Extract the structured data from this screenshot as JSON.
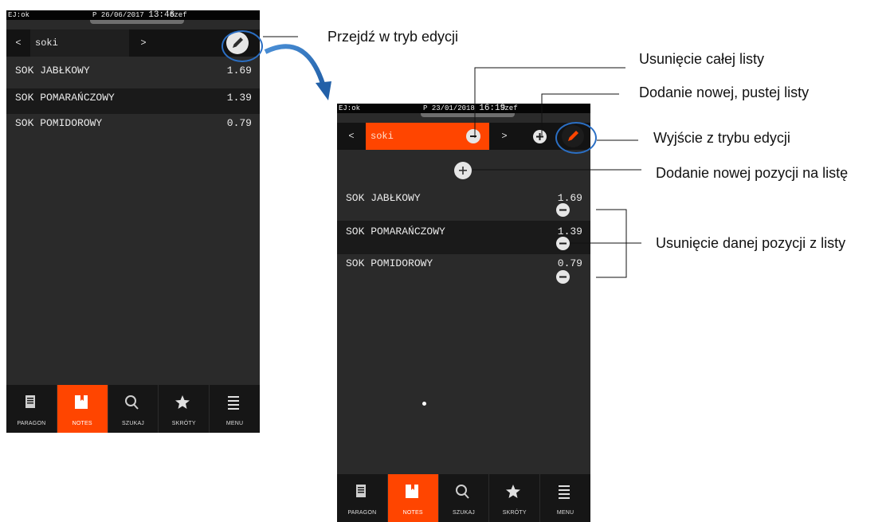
{
  "phone_view": {
    "status": {
      "ej": "EJ:ok",
      "prefix": "P",
      "date": "26/06/2017",
      "time": "13:46",
      "user": "Szef"
    },
    "list_name": "soki",
    "nav_prev": "<",
    "nav_next": ">",
    "items": [
      {
        "name": "SOK JABŁKOWY",
        "price": "1.69"
      },
      {
        "name": "SOK POMARAŃCZOWY",
        "price": "1.39"
      },
      {
        "name": "SOK POMIDOROWY",
        "price": "0.79"
      }
    ],
    "tabs": [
      {
        "label": "PARAGON",
        "icon": "receipt-icon"
      },
      {
        "label": "NOTES",
        "icon": "notes-icon"
      },
      {
        "label": "SZUKAJ",
        "icon": "search-icon"
      },
      {
        "label": "SKRÓTY",
        "icon": "star-icon"
      },
      {
        "label": "MENU",
        "icon": "menu-icon"
      }
    ],
    "active_tab": "NOTES"
  },
  "phone_edit": {
    "status": {
      "ej": "EJ:ok",
      "prefix": "P",
      "date": "23/01/2018",
      "time": "16:19",
      "user": "Szef"
    },
    "list_name": "soki",
    "nav_prev": "<",
    "nav_next": ">",
    "items": [
      {
        "name": "SOK JABŁKOWY",
        "price": "1.69"
      },
      {
        "name": "SOK POMARAŃCZOWY",
        "price": "1.39"
      },
      {
        "name": "SOK POMIDOROWY",
        "price": "0.79"
      }
    ],
    "tabs": [
      {
        "label": "PARAGON",
        "icon": "receipt-icon"
      },
      {
        "label": "NOTES",
        "icon": "notes-icon"
      },
      {
        "label": "SZUKAJ",
        "icon": "search-icon"
      },
      {
        "label": "SKRÓTY",
        "icon": "star-icon"
      },
      {
        "label": "MENU",
        "icon": "menu-icon"
      }
    ],
    "active_tab": "NOTES"
  },
  "annotations": {
    "enter_edit": "Przejdź w tryb edycji",
    "delete_list": "Usunięcie całej listy",
    "add_list": "Dodanie nowej, pustej listy",
    "exit_edit": "Wyjście z trybu edycji",
    "add_item": "Dodanie nowej pozycji na listę",
    "delete_item": "Usunięcie danej pozycji z listy"
  },
  "colors": {
    "accent": "#ff4500",
    "highlight_ring": "#2b6fc4",
    "background": "#2a2a2a"
  }
}
